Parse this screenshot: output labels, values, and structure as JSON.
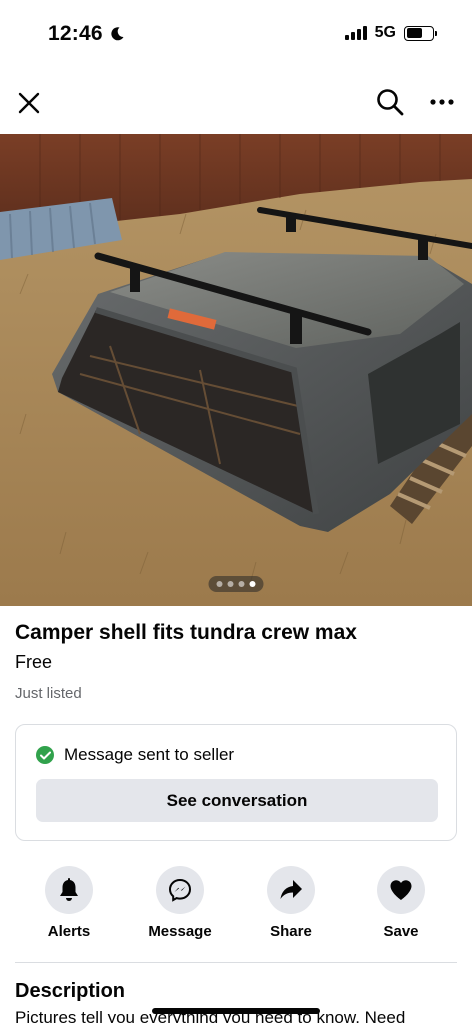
{
  "status_bar": {
    "time": "12:46",
    "network": "5G",
    "moon_icon": "moon-icon",
    "battery_level": 0.62
  },
  "top_bar": {
    "close_icon": "close-icon",
    "search_icon": "search-icon",
    "more_icon": "more-horizontal-icon"
  },
  "photo": {
    "page_count": 4,
    "active_page": 4
  },
  "listing": {
    "title": "Camper shell fits tundra crew max",
    "price": "Free",
    "time": "Just listed"
  },
  "message_card": {
    "status": "Message sent to seller",
    "button_label": "See conversation"
  },
  "actions": [
    {
      "label": "Alerts",
      "icon": "bell-icon"
    },
    {
      "label": "Message",
      "icon": "messenger-icon"
    },
    {
      "label": "Share",
      "icon": "share-arrow-icon"
    },
    {
      "label": "Save",
      "icon": "heart-icon"
    }
  ],
  "description": {
    "heading": "Description",
    "text": "Pictures tell you everything you need to know. Need"
  },
  "colors": {
    "success_green": "#31a24c",
    "button_gray": "#e4e6eb",
    "secondary_text": "#65676b"
  }
}
